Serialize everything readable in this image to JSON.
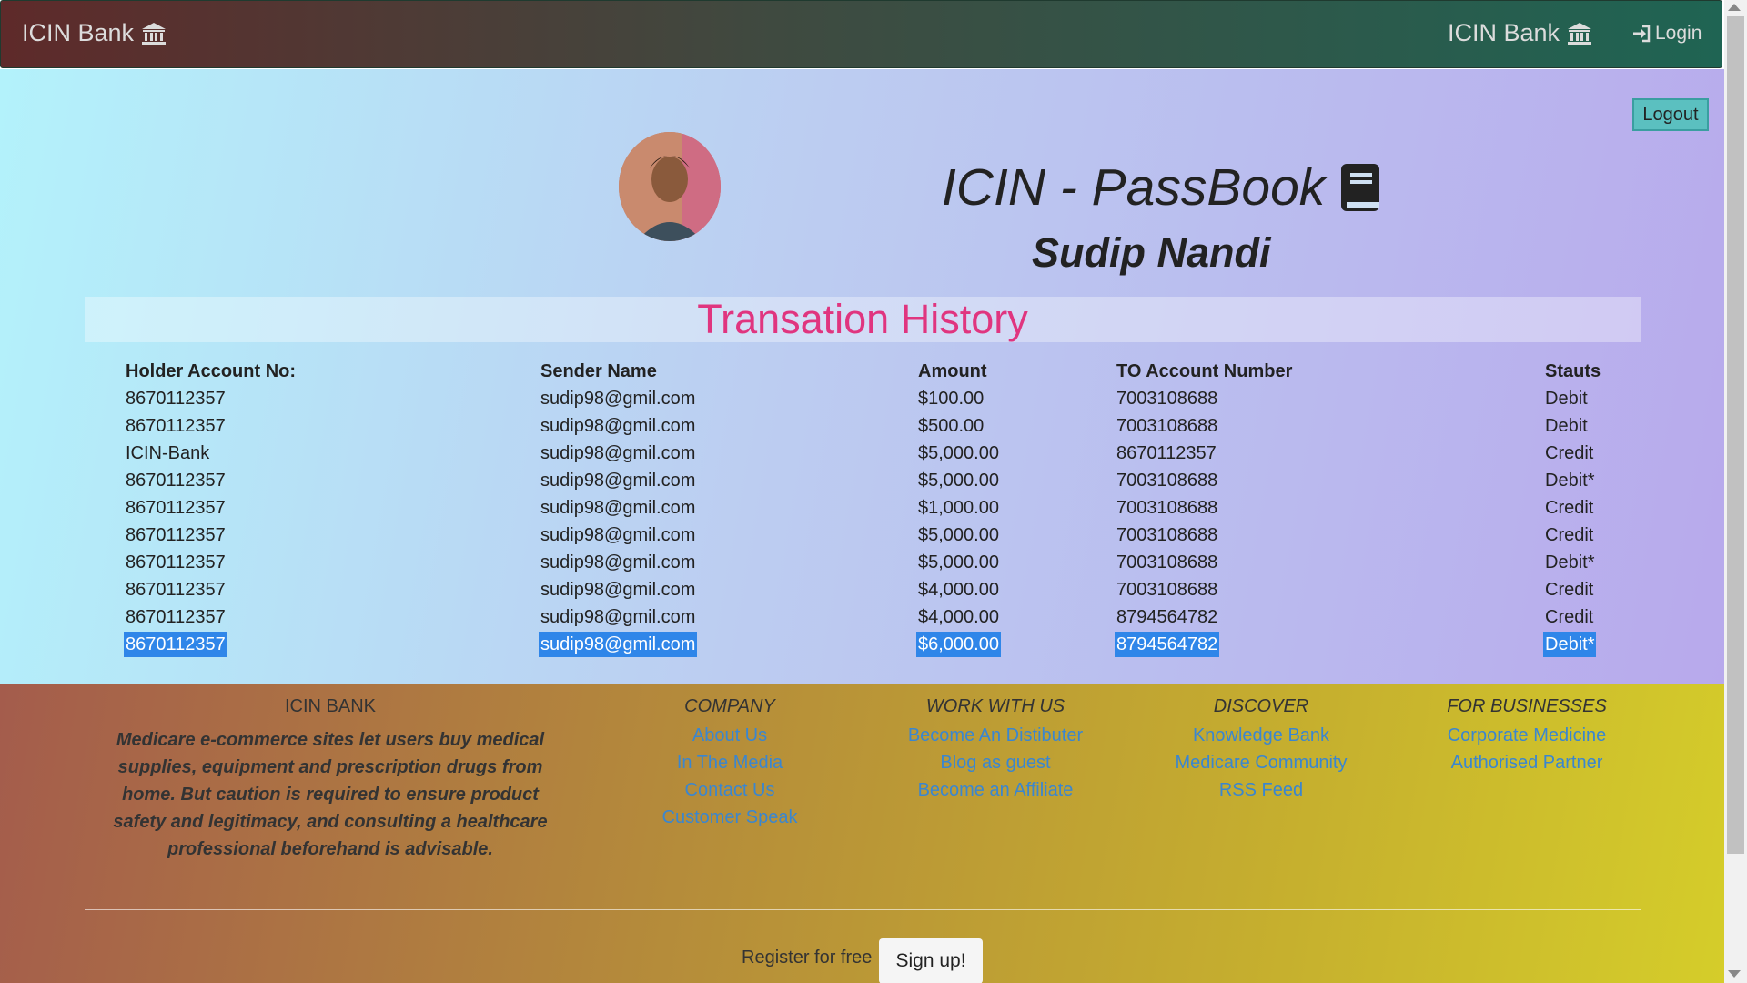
{
  "navbar": {
    "brand_left": "ICIN Bank",
    "brand_right": "ICIN Bank",
    "login_label": "Login"
  },
  "main": {
    "logout_label": "Logout",
    "page_title": "ICIN - PassBook",
    "user_name": "Sudip Nandi",
    "section_title": "Transation History"
  },
  "table": {
    "headers": [
      "Holder Account No:",
      "Sender Name",
      "Amount",
      "TO Account Number",
      "Stauts"
    ],
    "rows": [
      [
        "8670112357",
        "sudip98@gmil.com",
        "$100.00",
        "7003108688",
        "Debit"
      ],
      [
        "8670112357",
        "sudip98@gmil.com",
        "$500.00",
        "7003108688",
        "Debit"
      ],
      [
        "ICIN-Bank",
        "sudip98@gmil.com",
        "$5,000.00",
        "8670112357",
        "Credit"
      ],
      [
        "8670112357",
        "sudip98@gmil.com",
        "$5,000.00",
        "7003108688",
        "Debit*"
      ],
      [
        "8670112357",
        "sudip98@gmil.com",
        "$1,000.00",
        "7003108688",
        "Credit"
      ],
      [
        "8670112357",
        "sudip98@gmil.com",
        "$5,000.00",
        "7003108688",
        "Credit"
      ],
      [
        "8670112357",
        "sudip98@gmil.com",
        "$5,000.00",
        "7003108688",
        "Debit*"
      ],
      [
        "8670112357",
        "sudip98@gmil.com",
        "$4,000.00",
        "7003108688",
        "Credit"
      ],
      [
        "8670112357",
        "sudip98@gmil.com",
        "$4,000.00",
        "8794564782",
        "Credit"
      ],
      [
        "8670112357",
        "sudip98@gmil.com",
        "$6,000.00",
        "8794564782",
        "Debit*"
      ]
    ],
    "selected_row": 9
  },
  "footer": {
    "bank": {
      "heading": "ICIN BANK",
      "description": "Medicare e-commerce sites let users buy medical supplies, equipment and prescription drugs from home. But caution is required to ensure product safety and legitimacy, and consulting a healthcare professional beforehand is advisable."
    },
    "company": {
      "heading": "COMPANY",
      "links": [
        "About Us",
        "In The Media",
        "Contact Us",
        "Customer Speak"
      ]
    },
    "work": {
      "heading": "WORK WITH US",
      "links": [
        "Become An Distibuter",
        "Blog as guest",
        "Become an Affiliate"
      ]
    },
    "discover": {
      "heading": "DISCOVER",
      "links": [
        "Knowledge Bank",
        "Medicare Community",
        "RSS Feed"
      ]
    },
    "business": {
      "heading": "FOR BUSINESSES",
      "links": [
        "Corporate Medicine",
        "Authorised Partner"
      ]
    },
    "register_text": "Register for free",
    "signup_label": "Sign up!"
  },
  "colors": {
    "section_title": "#e0357f",
    "footer_link": "#3a86d0",
    "selection": "#2f86e9",
    "logout_button": "#5bc0c0"
  },
  "icons": {
    "bank": "bank-icon",
    "login": "login-icon",
    "passbook": "book-icon"
  }
}
